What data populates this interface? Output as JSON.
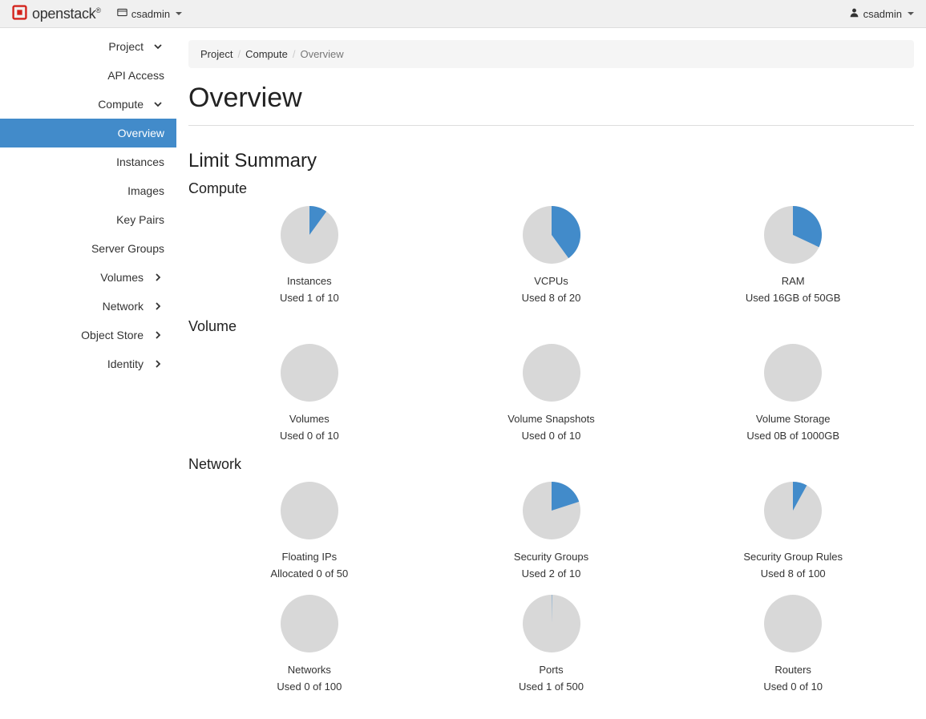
{
  "brand": {
    "name": "openstack"
  },
  "topbar": {
    "domain": "csadmin",
    "user": "csadmin"
  },
  "sidebar": {
    "sections": [
      {
        "label": "Project",
        "expanded": true,
        "children": [
          {
            "type": "link",
            "label": "API Access",
            "active": false
          },
          {
            "type": "group",
            "label": "Compute",
            "expanded": true,
            "children": [
              {
                "label": "Overview",
                "active": true
              },
              {
                "label": "Instances",
                "active": false
              },
              {
                "label": "Images",
                "active": false
              },
              {
                "label": "Key Pairs",
                "active": false
              },
              {
                "label": "Server Groups",
                "active": false
              }
            ]
          },
          {
            "type": "group",
            "label": "Volumes",
            "expanded": false
          },
          {
            "type": "group",
            "label": "Network",
            "expanded": false
          },
          {
            "type": "group",
            "label": "Object Store",
            "expanded": false
          }
        ]
      },
      {
        "label": "Identity",
        "expanded": false
      }
    ]
  },
  "breadcrumb": {
    "items": [
      "Project",
      "Compute",
      "Overview"
    ]
  },
  "page": {
    "title": "Overview",
    "limit_summary_title": "Limit Summary"
  },
  "chart_data": [
    {
      "group": "Compute",
      "items": [
        {
          "type": "pie",
          "title": "Instances",
          "used": 1,
          "total": 10,
          "usage_text": "Used 1 of 10"
        },
        {
          "type": "pie",
          "title": "VCPUs",
          "used": 8,
          "total": 20,
          "usage_text": "Used 8 of 20"
        },
        {
          "type": "pie",
          "title": "RAM",
          "used": 16,
          "total": 50,
          "unit": "GB",
          "usage_text": "Used 16GB of 50GB"
        }
      ]
    },
    {
      "group": "Volume",
      "items": [
        {
          "type": "pie",
          "title": "Volumes",
          "used": 0,
          "total": 10,
          "usage_text": "Used 0 of 10"
        },
        {
          "type": "pie",
          "title": "Volume Snapshots",
          "used": 0,
          "total": 10,
          "usage_text": "Used 0 of 10"
        },
        {
          "type": "pie",
          "title": "Volume Storage",
          "used": 0,
          "total": 1000,
          "unit": "GB",
          "usage_text": "Used 0B of 1000GB"
        }
      ]
    },
    {
      "group": "Network",
      "items": [
        {
          "type": "pie",
          "title": "Floating IPs",
          "used": 0,
          "total": 50,
          "usage_text": "Allocated 0 of 50"
        },
        {
          "type": "pie",
          "title": "Security Groups",
          "used": 2,
          "total": 10,
          "usage_text": "Used 2 of 10"
        },
        {
          "type": "pie",
          "title": "Security Group Rules",
          "used": 8,
          "total": 100,
          "usage_text": "Used 8 of 100"
        },
        {
          "type": "pie",
          "title": "Networks",
          "used": 0,
          "total": 100,
          "usage_text": "Used 0 of 100"
        },
        {
          "type": "pie",
          "title": "Ports",
          "used": 1,
          "total": 500,
          "usage_text": "Used 1 of 500"
        },
        {
          "type": "pie",
          "title": "Routers",
          "used": 0,
          "total": 10,
          "usage_text": "Used 0 of 10"
        }
      ]
    }
  ],
  "colors": {
    "pie_used": "#428bca",
    "pie_free": "#d8d8d8"
  }
}
